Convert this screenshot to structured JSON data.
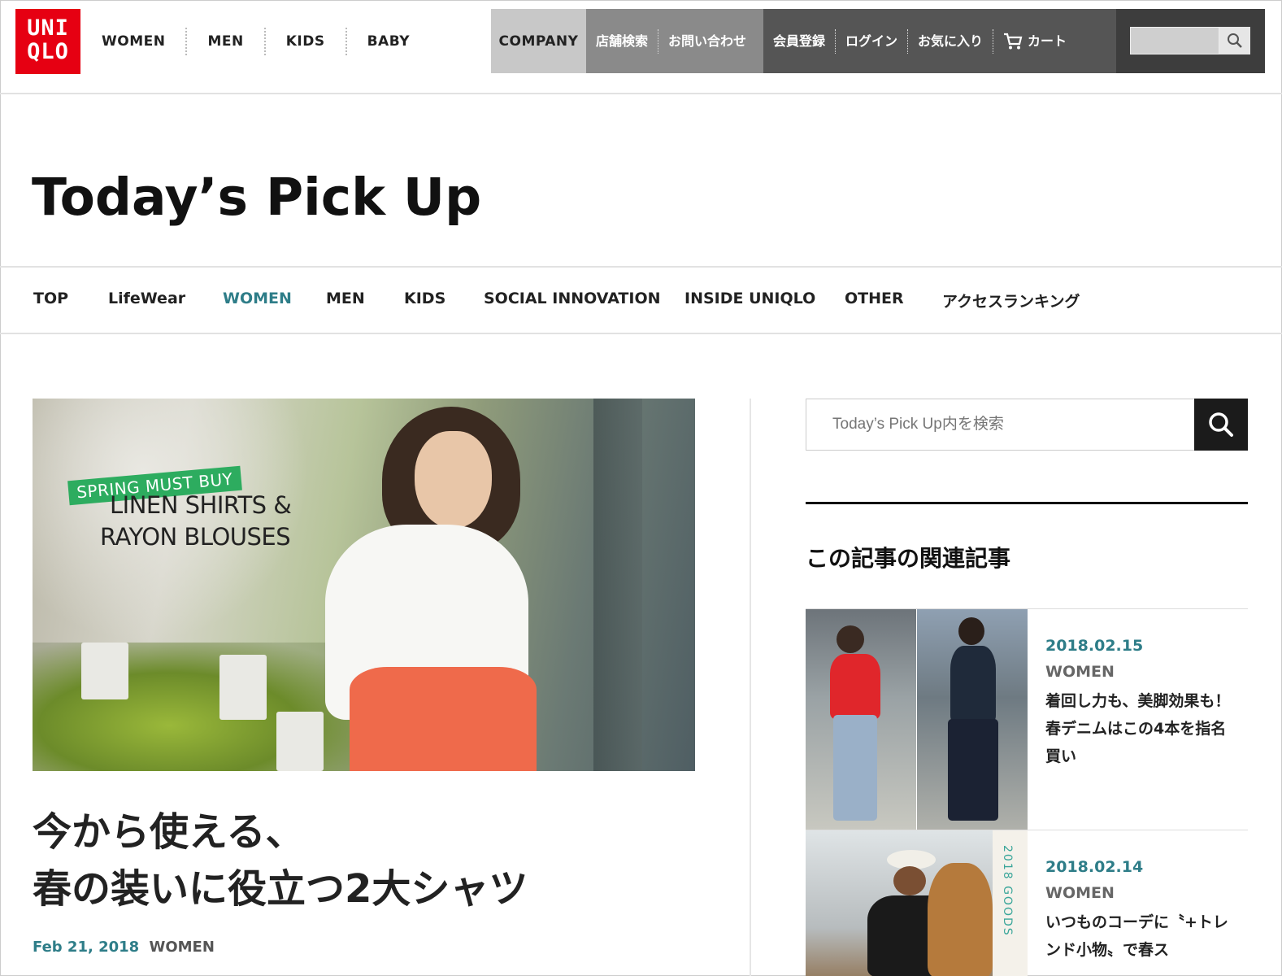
{
  "brand": {
    "logo_line1": "UNI",
    "logo_line2": "QLO",
    "color": "#e60012"
  },
  "main_nav": [
    "WOMEN",
    "MEN",
    "KIDS",
    "BABY"
  ],
  "utility_nav": {
    "company": "COMPANY",
    "mid_links": [
      "店舗検索",
      "お問い合わせ"
    ],
    "account_links": [
      "会員登録",
      "ログイン",
      "お気に入り"
    ],
    "cart": "カート"
  },
  "page": {
    "title": "Today’s Pick Up"
  },
  "category_nav": {
    "items": [
      "TOP",
      "LifeWear",
      "WOMEN",
      "MEN",
      "KIDS",
      "SOCIAL INNOVATION",
      "INSIDE UNIQLO",
      "OTHER",
      "アクセスランキング"
    ],
    "active": "WOMEN",
    "accent": "#2e7d88"
  },
  "hero": {
    "tag": "SPRING MUST BUY",
    "line1": "LINEN SHIRTS &",
    "line2": "RAYON BLOUSES",
    "tag_color": "#2dac5f"
  },
  "article": {
    "title_line1": "今から使える、",
    "title_line2": "春の装いに役立つ2大シャツ",
    "date": "Feb 21, 2018",
    "category": "WOMEN"
  },
  "sidebar": {
    "search_placeholder": "Today’s Pick Up内を検索",
    "related_heading": "この記事の関連記事",
    "related": [
      {
        "date": "2018.02.15",
        "category": "WOMEN",
        "title": "着回し力も、美脚効果も！ 春デニムはこの4本を指名買い"
      },
      {
        "date": "2018.02.14",
        "category": "WOMEN",
        "title": "いつものコーデに〝+トレンド小物〟で春ス"
      }
    ],
    "thumb2_vertical_text": "2018 GOODS"
  }
}
